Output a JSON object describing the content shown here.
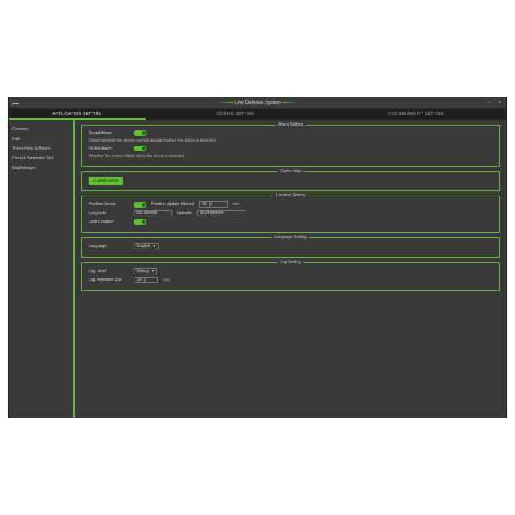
{
  "header": {
    "title": "UAV Defense System"
  },
  "tabs": [
    "APPLICATION SETTING",
    "CONFIG SETTING",
    "SYSTEM ABILITY SETTING"
  ],
  "sidebar": [
    "Common",
    "Path",
    "Three-Party Software",
    "Correct Parameter Sett",
    "MapManager"
  ],
  "groups": {
    "alarm": {
      "title": "Alarm Setting",
      "sound_label": "Sound Alarm",
      "sound_desc": "Detect whether the device sounds an alarm when the drone is detected",
      "flicker_label": "Flicker Alarm",
      "flicker_desc": "Whether the screen blinks when the drone is detected"
    },
    "cache": {
      "title": "Cache data",
      "clear_label": "CLEAR DATA"
    },
    "location": {
      "title": "Location Setting",
      "pos_server_label": "Position Server",
      "pos_update_label": "Position Update Interval",
      "pos_update_value": "30",
      "pos_update_unit": "min",
      "lon_label": "Longitude:",
      "lon_value": "120.290666",
      "lat_label": "Latitude:",
      "lat_value": "30.24566624",
      "lock_label": "Lock Location:"
    },
    "language": {
      "title": "Language Setting",
      "lang_label": "Language:",
      "lang_value": "English"
    },
    "log": {
      "title": "Log Setting",
      "level_label": "Log Level:",
      "level_value": "Debug",
      "retention_label": "Log Retention Dur",
      "retention_value": "30",
      "retention_unit": "Day"
    }
  },
  "colors": {
    "accent": "#5fbf2f",
    "bg": "#3a3a3a",
    "tabbar": "#1f1f1f"
  }
}
